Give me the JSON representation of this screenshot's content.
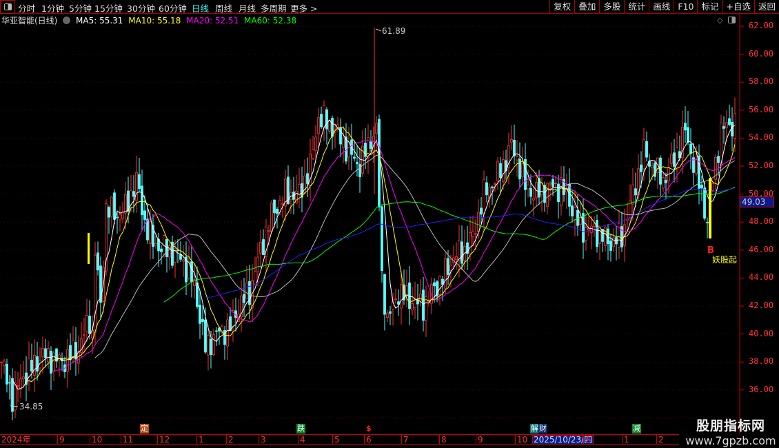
{
  "toolbar": {
    "periods": [
      "分时",
      "1分钟",
      "5分钟",
      "15分钟",
      "30分钟",
      "60分钟",
      "日线",
      "周线",
      "月线",
      "多周期",
      "更多 >"
    ],
    "active": "日线",
    "right_buttons": [
      "复权",
      "叠加",
      "多股",
      "统计",
      "画线",
      "F10",
      "标记",
      "+自选",
      "返回"
    ]
  },
  "info": {
    "title": "华亚智能(日线)",
    "ma5": "MA5: 55.31",
    "ma10": "MA10: 55.18",
    "ma20": "MA20: 52.51",
    "ma60": "MA60: 52.38"
  },
  "colors": {
    "up": "#ff3232",
    "down": "#54ffff",
    "ma5": "#ffffff",
    "ma10": "#ffff00",
    "ma20": "#ff00ff",
    "ma60": "#00ff00",
    "long1": "#bbbbbb",
    "long2": "#2222ff"
  },
  "axis": {
    "labels": [
      "62.00",
      "60.00",
      "58.00",
      "56.00",
      "54.00",
      "52.00",
      "50.00",
      "48.00",
      "46.00",
      "44.00",
      "42.00",
      "40.00",
      "38.00",
      "36.00"
    ],
    "current_price": "49.03"
  },
  "annotations": {
    "high": "61.89",
    "low": "34.85",
    "signal_letter": "B",
    "signal_text": "妖股起"
  },
  "markers": [
    {
      "text": "定",
      "color": "#c04a10"
    },
    {
      "text": "跌",
      "color": "#0a8a2a"
    },
    {
      "text": "$",
      "color": "#000"
    },
    {
      "text": "解",
      "color": "#087878"
    },
    {
      "text": "财",
      "color": "#0a2a6a"
    },
    {
      "text": "减",
      "color": "#0a8a2a"
    }
  ],
  "dates": [
    "2024年",
    "9",
    "10",
    "11",
    "12",
    "1",
    "2",
    "3",
    "4",
    "5",
    "6",
    "7",
    "8",
    "9",
    "10",
    "2",
    "1",
    "2"
  ],
  "cursor_date": "2025/10/23/四",
  "watermark": {
    "line1": "股朋指标网",
    "line2": "www.7gpzb.com"
  },
  "chart_data": {
    "type": "candlestick",
    "ylim": [
      35,
      62.5
    ],
    "days": 267,
    "close_keypoints": [
      [
        0,
        38
      ],
      [
        4,
        35.5
      ],
      [
        8,
        37
      ],
      [
        15,
        38.5
      ],
      [
        22,
        38
      ],
      [
        28,
        39
      ],
      [
        33,
        40
      ],
      [
        36,
        42
      ],
      [
        32,
        41
      ],
      [
        34,
        46
      ],
      [
        38,
        49
      ],
      [
        42,
        48.5
      ],
      [
        45,
        49
      ],
      [
        49,
        51
      ],
      [
        52,
        48
      ],
      [
        55,
        46.5
      ],
      [
        60,
        46
      ],
      [
        65,
        45.5
      ],
      [
        70,
        43.5
      ],
      [
        74,
        39
      ],
      [
        78,
        40
      ],
      [
        83,
        40.5
      ],
      [
        86,
        42
      ],
      [
        90,
        43
      ],
      [
        94,
        46
      ],
      [
        98,
        48.5
      ],
      [
        103,
        50
      ],
      [
        108,
        50
      ],
      [
        112,
        52
      ],
      [
        115,
        55.5
      ],
      [
        119,
        55
      ],
      [
        123,
        54
      ],
      [
        126,
        53
      ],
      [
        130,
        52
      ],
      [
        134,
        54
      ],
      [
        136,
        54.5
      ],
      [
        138,
        44
      ],
      [
        140,
        41
      ],
      [
        144,
        43
      ],
      [
        148,
        42.5
      ],
      [
        153,
        42
      ],
      [
        156,
        43
      ],
      [
        160,
        44
      ],
      [
        164,
        45.5
      ],
      [
        168,
        46
      ],
      [
        171,
        47
      ],
      [
        175,
        50
      ],
      [
        179,
        51
      ],
      [
        183,
        52.5
      ],
      [
        185,
        53.5
      ],
      [
        188,
        52
      ],
      [
        190,
        50.5
      ],
      [
        194,
        50
      ],
      [
        198,
        50.5
      ],
      [
        203,
        50.5
      ],
      [
        206,
        49.5
      ],
      [
        210,
        47.5
      ],
      [
        214,
        47.5
      ],
      [
        218,
        47
      ],
      [
        221,
        46.5
      ],
      [
        225,
        47
      ],
      [
        229,
        50
      ],
      [
        233,
        53
      ],
      [
        236,
        52
      ],
      [
        240,
        51
      ],
      [
        244,
        52.5
      ],
      [
        248,
        54.5
      ],
      [
        250,
        53
      ],
      [
        254,
        50
      ],
      [
        256,
        48
      ],
      [
        258,
        51
      ],
      [
        261,
        54.5
      ],
      [
        264,
        55
      ],
      [
        266,
        55
      ]
    ],
    "high": 61.89,
    "low": 34.85,
    "series": [
      "MA5",
      "MA10",
      "MA20",
      "MA60"
    ]
  }
}
